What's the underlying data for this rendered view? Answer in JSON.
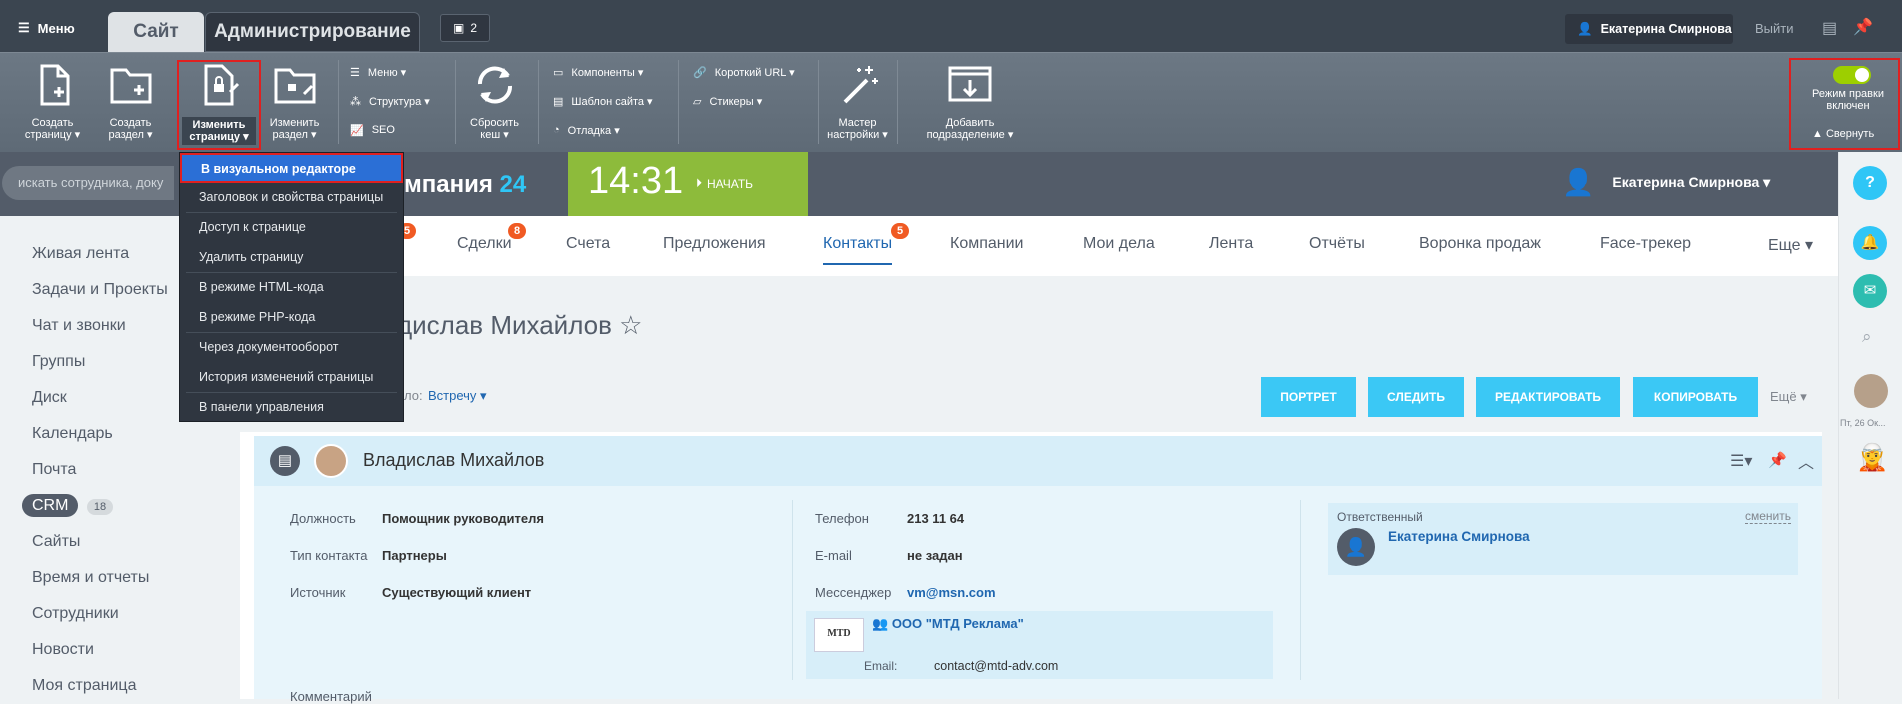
{
  "topbar": {
    "menu_label": "Меню",
    "tab_site": "Сайт",
    "tab_admin": "Администрирование",
    "notifications_count": "2",
    "user_name": "Екатерина Смирнова",
    "logout": "Выйти"
  },
  "toolbar": {
    "create_page": "Создать странице",
    "create_page_arrow": "страницу ▾",
    "create_section_l1": "Создать",
    "create_section_l2": "раздел ▾",
    "edit_page_l1": "Изменить",
    "edit_page_l2": "страницу ▾",
    "edit_section_l1": "Изменить",
    "edit_section_l2": "раздел ▾",
    "menu": "Меню ▾",
    "structure": "Структура ▾",
    "seo": "SEO",
    "reset_cache_l1": "Сбросить",
    "reset_cache_l2": "кеш ▾",
    "components": "Компоненты ▾",
    "site_template": "Шаблон сайта ▾",
    "debug": "Отладка ▾",
    "short_url": "Короткий URL ▾",
    "stickers": "Стикеры ▾",
    "wizard_l1": "Мастер",
    "wizard_l2": "настройки ▾",
    "add_subsection_l1": "Добавить",
    "add_subsection_l2": "подразделение ▾",
    "edit_mode_l1": "Режим правки",
    "edit_mode_l2": "включен",
    "collapse": "▲ Свернуть"
  },
  "dropdown": [
    "В визуальном редакторе",
    "Заголовок и свойства страницы",
    "Доступ к странице",
    "Удалить страницу",
    "В режиме HTML-кода",
    "В режиме PHP-кода",
    "Через документооборот",
    "История изменений страницы",
    "В панели управления"
  ],
  "header": {
    "search_placeholder": "искать сотрудника, доку",
    "company": "мпания",
    "company_num": "24",
    "time": "14:31",
    "start": "НАЧАТЬ",
    "user": "Екатерина Смирнова ▾"
  },
  "nav": [
    "Живая лента",
    "Задачи и Проекты",
    "Чат и звонки",
    "Группы",
    "Диск",
    "Календарь",
    "Почта",
    "CRM",
    "Сайты",
    "Время и отчеты",
    "Сотрудники",
    "Новости",
    "Моя страница"
  ],
  "crm_count": "18",
  "tabs": [
    {
      "label": "Сделки",
      "badge": "8"
    },
    {
      "label": "Счета"
    },
    {
      "label": "Предложения"
    },
    {
      "label": "Контакты",
      "badge": "5"
    },
    {
      "label": "Компании"
    },
    {
      "label": "Мои дела"
    },
    {
      "label": "Лента"
    },
    {
      "label": "Отчёты"
    },
    {
      "label": "Воронка продаж"
    },
    {
      "label": "Face-трекер"
    },
    {
      "label": "Еще ▾"
    }
  ],
  "leads_badge": "5",
  "contact": {
    "title": "Владислав Михайлов ☆",
    "stage_label": "ло:",
    "stage_value": "Встречу ▾",
    "name": "Владислав Михайлов"
  },
  "buttons": {
    "portrait": "ПОРТРЕТ",
    "follow": "СЛЕДИТЬ",
    "edit": "РЕДАКТИРОВАТЬ",
    "copy": "КОПИРОВАТЬ",
    "more": "Ещё ▾"
  },
  "fields": {
    "position_l": "Должность",
    "position_v": "Помощник руководителя",
    "type_l": "Тип контакта",
    "type_v": "Партнеры",
    "source_l": "Источник",
    "source_v": "Существующий клиент",
    "phone_l": "Телефон",
    "phone_v": "213 11 64",
    "email_l": "E-mail",
    "email_v": "не задан",
    "messenger_l": "Мессенджер",
    "messenger_v": "vm@msn.com",
    "company_name": "ООО \"МТД Реклама\"",
    "company_email_l": "Email:",
    "company_email_v": "contact@mtd-adv.com",
    "logo_text": "МТD",
    "responsible_l": "Ответственный",
    "change": "сменить",
    "responsible_v": "Екатерина Смирнова",
    "comment_l": "Комментарий"
  },
  "rightbar": {
    "help": "?",
    "date": "Пт, 26 Ок..."
  }
}
